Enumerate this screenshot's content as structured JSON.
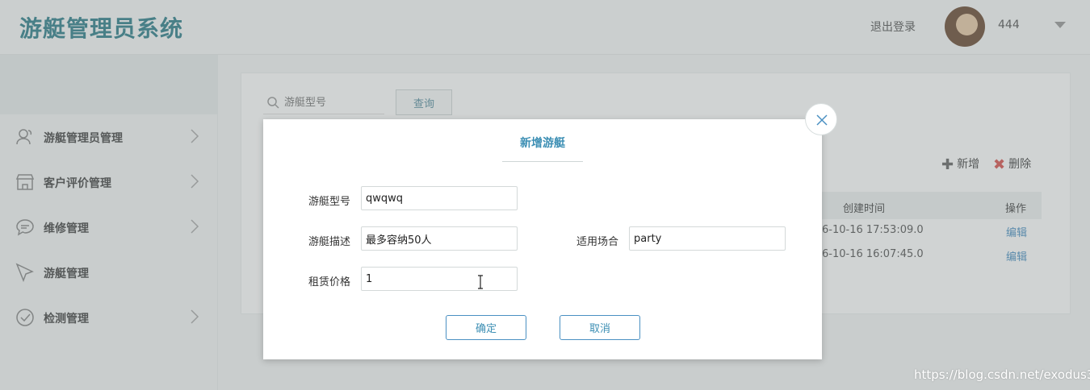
{
  "header": {
    "app_title": "游艇管理员系统",
    "logout_label": "退出登录",
    "username": "444"
  },
  "sidebar": {
    "items": [
      {
        "label": "游艇管理员管理",
        "icon": "user-icon"
      },
      {
        "label": "客户评价管理",
        "icon": "store-icon"
      },
      {
        "label": "维修管理",
        "icon": "chat-icon"
      },
      {
        "label": "游艇管理",
        "icon": "pointer-icon"
      },
      {
        "label": "检测管理",
        "icon": "check-circle-icon"
      }
    ]
  },
  "toolbar": {
    "search_placeholder": "游艇型号",
    "query_label": "查询",
    "add_label": "新增",
    "delete_label": "删除"
  },
  "table": {
    "columns": [
      "创建时间",
      "操作"
    ],
    "rows": [
      {
        "created": "6-10-16 17:53:09.0",
        "action": "编辑"
      },
      {
        "created": "6-10-16 16:07:45.0",
        "action": "编辑"
      }
    ]
  },
  "modal": {
    "title": "新增游艇",
    "fields": {
      "model_label": "游艇型号",
      "model_value": "qwqwq",
      "desc_label": "游艇描述",
      "desc_value": "最多容纳50人",
      "occasion_label": "适用场合",
      "occasion_value": "party",
      "price_label": "租赁价格",
      "price_value": "1"
    },
    "confirm_label": "确定",
    "cancel_label": "取消"
  },
  "watermark": "https://blog.csdn.net/exodus3",
  "colors": {
    "brand": "#2f7f8a",
    "accent": "#3d8fb4",
    "danger": "#d9534f"
  }
}
